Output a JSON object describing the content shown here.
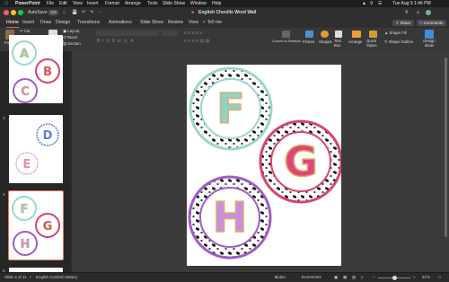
{
  "menubar": {
    "app_name": "PowerPoint",
    "items": [
      "File",
      "Edit",
      "View",
      "Insert",
      "Format",
      "Arrange",
      "Tools",
      "Slide Show",
      "Window",
      "Help"
    ],
    "datetime": "Tue Aug 9  1:46 PM"
  },
  "titlebar": {
    "autosave": "AutoSave",
    "autosave_state": "OFF",
    "document_title": "English Chenille Word Wall"
  },
  "tabs": [
    "Home",
    "Insert",
    "Draw",
    "Design",
    "Transitions",
    "Animations",
    "Slide Show",
    "Review",
    "View",
    "Tell me"
  ],
  "share_label": "Share",
  "comments_label": "Comments",
  "ribbon": {
    "paste": "Paste",
    "cut": "Cut",
    "copy": "Copy",
    "format": "Format",
    "new_slide": "New Slide",
    "layout": "Layout",
    "reset": "Reset",
    "section": "Section",
    "convert_smartart": "Convert to SmartArt",
    "picture": "Picture",
    "shapes": "Shapes",
    "text_box": "Text Box",
    "arrange": "Arrange",
    "quick_styles": "Quick Styles",
    "shape_fill": "Shape Fill",
    "shape_outline": "Shape Outline",
    "design_ideas": "Design Ideas"
  },
  "slides": [
    {
      "number": "",
      "letters": [
        "A",
        "B",
        "C"
      ]
    },
    {
      "number": "3",
      "letters": [
        "D",
        "E"
      ]
    },
    {
      "number": "4",
      "letters": [
        "F",
        "G",
        "H"
      ]
    },
    {
      "number": "5",
      "letters": []
    }
  ],
  "main_slide": {
    "letters": [
      "F",
      "G",
      "H"
    ]
  },
  "statusbar": {
    "slide_info": "Slide 4 of 11",
    "language": "English (United States)",
    "notes": "Notes",
    "comments": "Comments",
    "zoom": "61%"
  },
  "colors": {
    "teal_ring": "#9ed6cc",
    "pink_ring": "#d6456f",
    "purple_ring": "#a05cc4",
    "letter_teal": "#8fd3c7",
    "letter_pink": "#e0457a",
    "letter_purple": "#c98ee0",
    "gold": "#d8b26a"
  }
}
